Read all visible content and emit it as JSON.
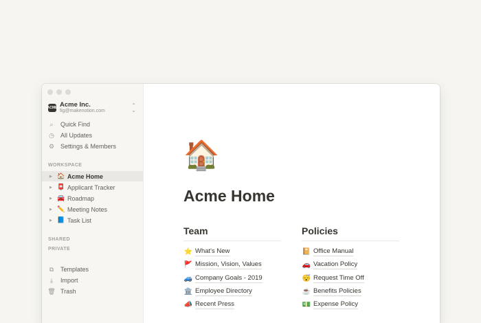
{
  "workspace": {
    "name": "Acme Inc.",
    "email": "fig@makenotion.com",
    "logo_text": "ACME"
  },
  "nav": [
    {
      "label": "Quick Find",
      "icon": "search-icon",
      "glyph": "⌕"
    },
    {
      "label": "All Updates",
      "icon": "clock-icon",
      "glyph": "◷"
    },
    {
      "label": "Settings & Members",
      "icon": "gear-icon",
      "glyph": "⚙"
    }
  ],
  "sections": {
    "workspace": "WORKSPACE",
    "shared": "SHARED",
    "private": "PRIVATE"
  },
  "pages": [
    {
      "label": "Acme Home",
      "emoji": "🏠",
      "active": true
    },
    {
      "label": "Applicant Tracker",
      "emoji": "📮",
      "active": false
    },
    {
      "label": "Roadmap",
      "emoji": "🚘",
      "active": false
    },
    {
      "label": "Meeting Notes",
      "emoji": "✏️",
      "active": false
    },
    {
      "label": "Task List",
      "emoji": "📘",
      "active": false
    }
  ],
  "footer_nav": [
    {
      "label": "Templates",
      "icon": "templates-icon",
      "glyph": "⧉"
    },
    {
      "label": "Import",
      "icon": "import-icon",
      "glyph": "⤓"
    },
    {
      "label": "Trash",
      "icon": "trash-icon",
      "glyph": "🗑"
    }
  ],
  "page": {
    "icon": "🏠",
    "title": "Acme Home"
  },
  "columns": [
    {
      "heading": "Team",
      "items": [
        {
          "emoji": "⭐",
          "label": "What's New"
        },
        {
          "emoji": "🚩",
          "label": "Mission, Vision, Values"
        },
        {
          "emoji": "🚙",
          "label": "Company Goals - 2019"
        },
        {
          "emoji": "🏛️",
          "label": "Employee Directory"
        },
        {
          "emoji": "📣",
          "label": "Recent Press"
        }
      ]
    },
    {
      "heading": "Policies",
      "items": [
        {
          "emoji": "📔",
          "label": "Office Manual"
        },
        {
          "emoji": "🚗",
          "label": "Vacation Policy"
        },
        {
          "emoji": "😴",
          "label": "Request Time Off"
        },
        {
          "emoji": "☕",
          "label": "Benefits Policies"
        },
        {
          "emoji": "💵",
          "label": "Expense Policy"
        }
      ]
    }
  ]
}
